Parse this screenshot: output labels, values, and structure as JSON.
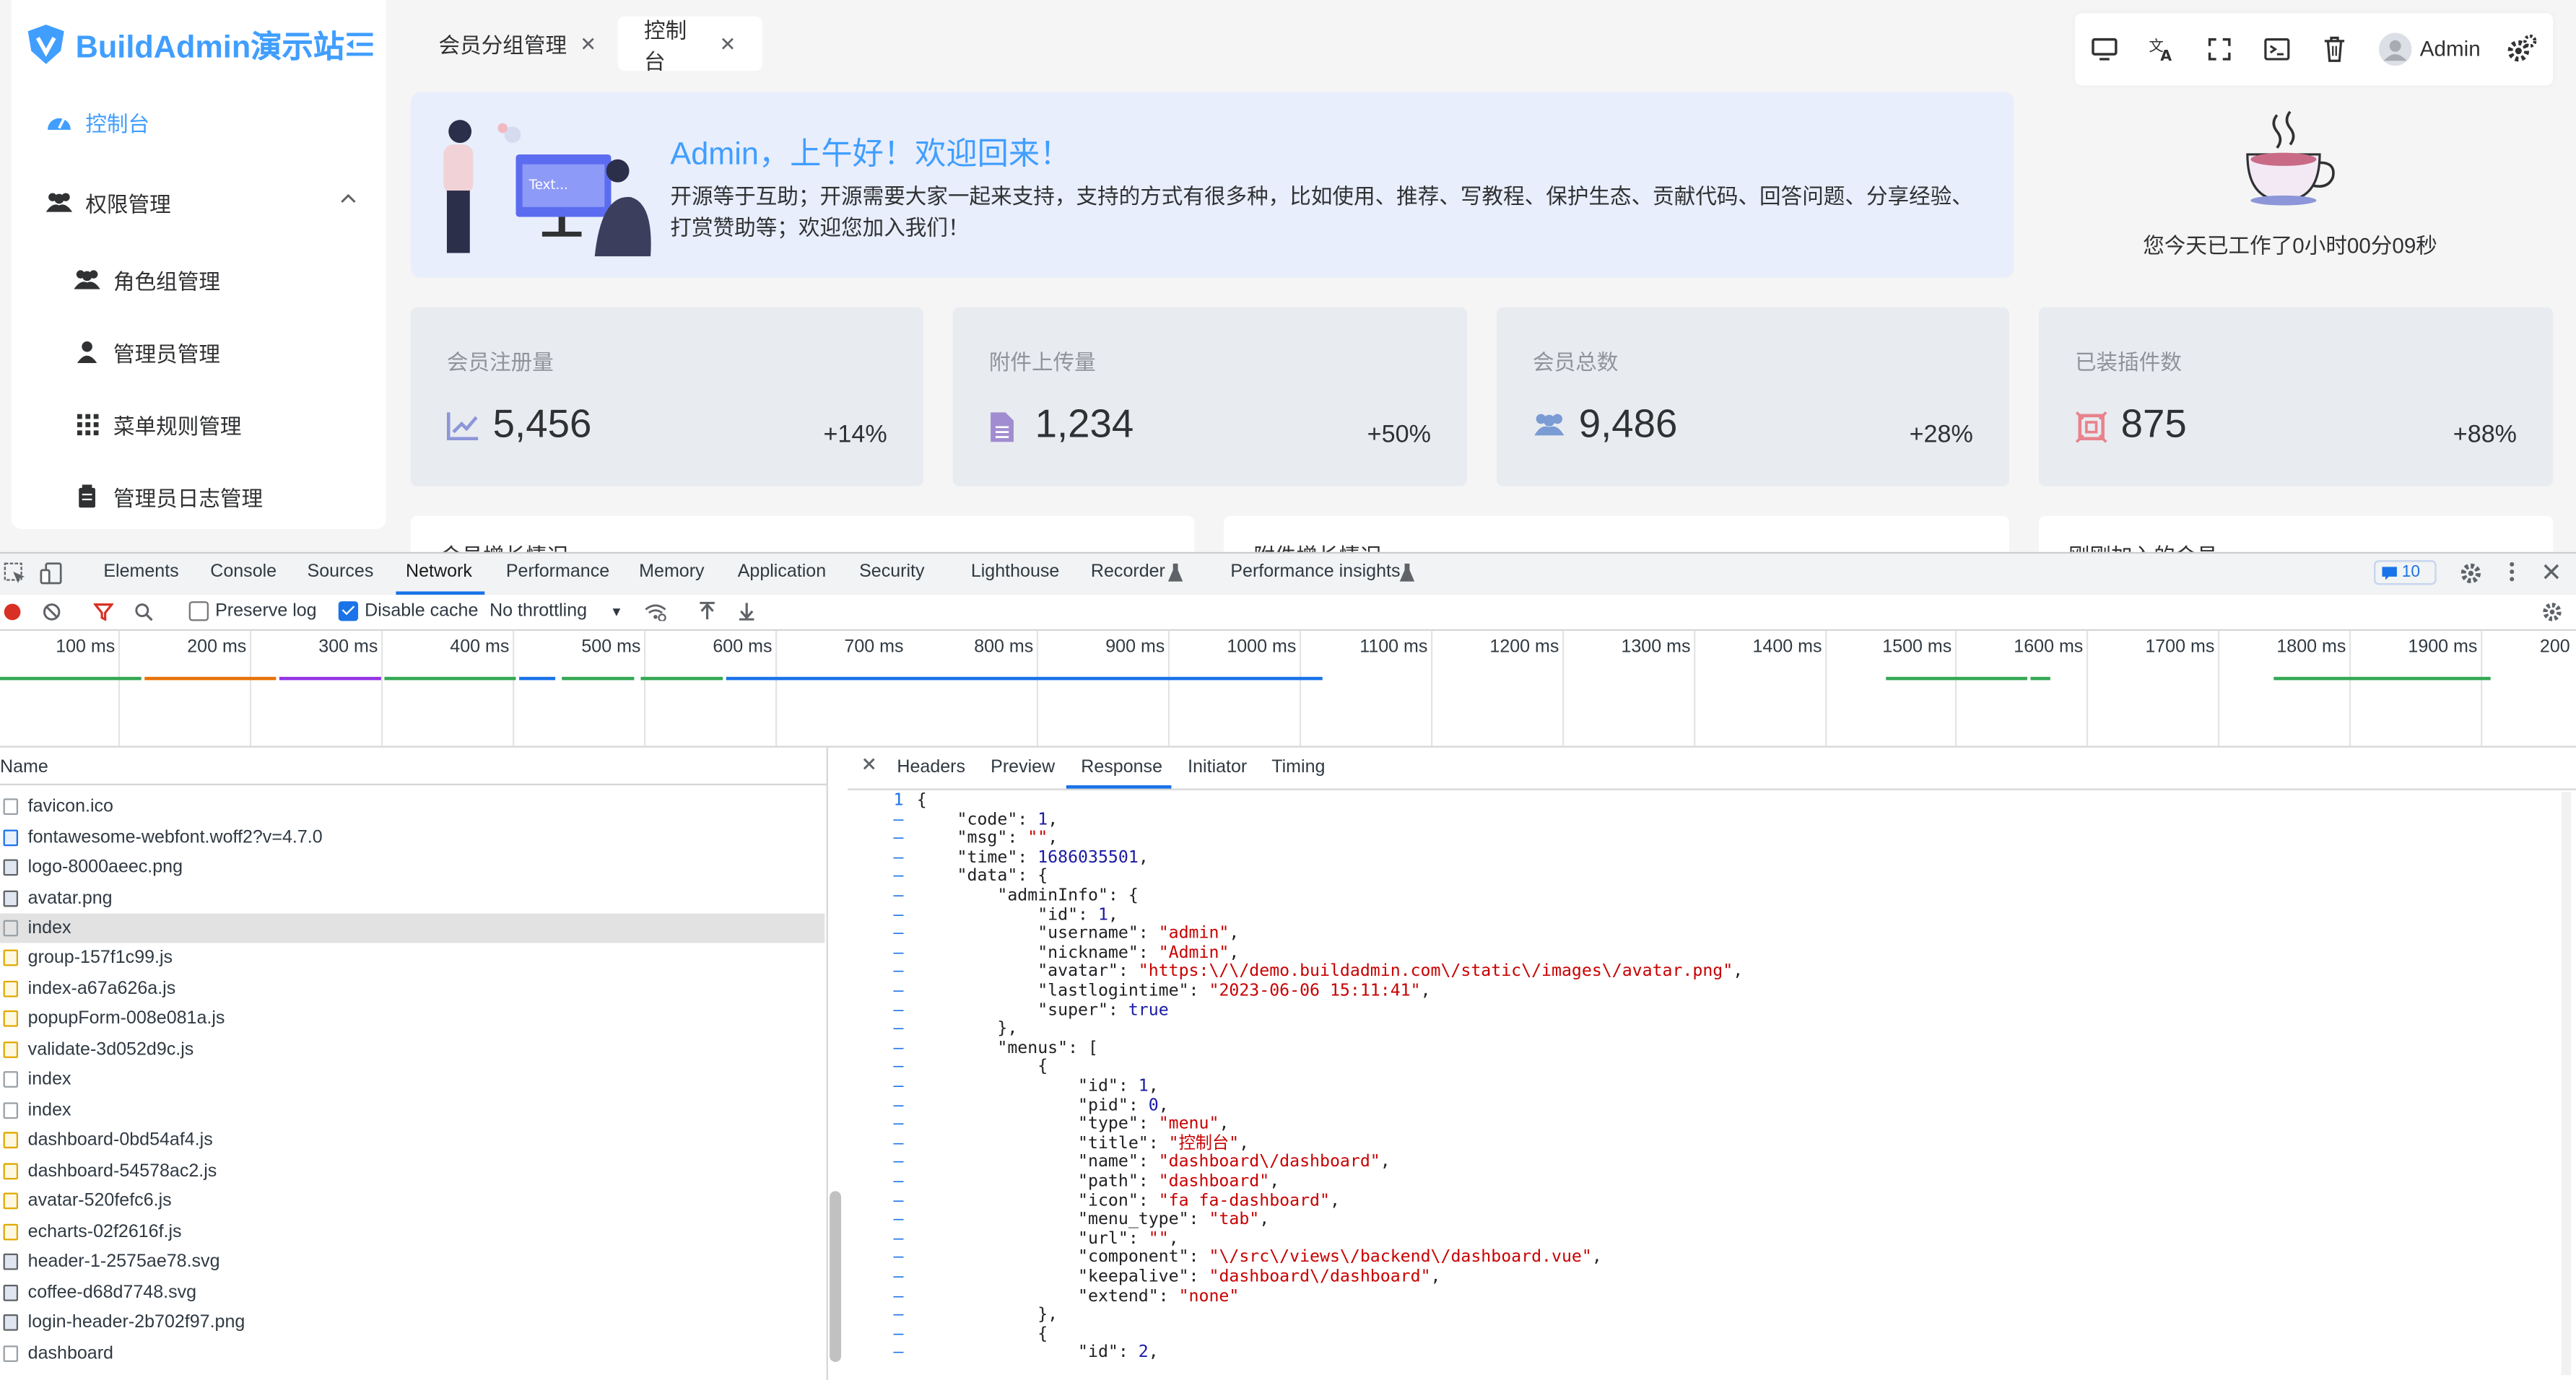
{
  "app": {
    "brand": "BuildAdmin演示站",
    "accent_color": "#409eff"
  },
  "sidebar": {
    "items": [
      {
        "label": "控制台",
        "icon": "dashboard-icon",
        "active": true
      },
      {
        "label": "权限管理",
        "icon": "users-icon",
        "expanded": true
      },
      {
        "label": "角色组管理",
        "icon": "users-group-icon"
      },
      {
        "label": "管理员管理",
        "icon": "user-icon"
      },
      {
        "label": "菜单规则管理",
        "icon": "grid-icon"
      },
      {
        "label": "管理员日志管理",
        "icon": "log-icon"
      }
    ]
  },
  "tabs": [
    {
      "label": "会员分组管理",
      "active": false
    },
    {
      "label": "控制台",
      "active": true
    }
  ],
  "toolbar": {
    "user_name": "Admin",
    "icons": [
      "monitor-icon",
      "translate-icon",
      "fullscreen-icon",
      "terminal-icon",
      "trash-icon",
      "avatar",
      "settings-icon"
    ]
  },
  "welcome": {
    "title": "Admin，上午好！欢迎回来！",
    "description": "开源等于互助；开源需要大家一起来支持，支持的方式有很多种，比如使用、推荐、写教程、保护生态、贡献代码、回答问题、分享经验、打赏赞助等；欢迎您加入我们！",
    "illustration_label": "Text...",
    "work_time": "您今天已工作了0小时00分09秒"
  },
  "stats": [
    {
      "label": "会员注册量",
      "value": "5,456",
      "change": "+14%",
      "icon": "trend-icon"
    },
    {
      "label": "附件上传量",
      "value": "1,234",
      "change": "+50%",
      "icon": "file-icon"
    },
    {
      "label": "会员总数",
      "value": "9,486",
      "change": "+28%",
      "icon": "users-icon"
    },
    {
      "label": "已装插件数",
      "value": "875",
      "change": "+88%",
      "icon": "plugin-icon"
    }
  ],
  "panels": [
    "会员增长情况",
    "附件增长情况",
    "刚刚加入的会员"
  ],
  "devtools": {
    "tabs": [
      "Elements",
      "Console",
      "Sources",
      "Network",
      "Performance",
      "Memory",
      "Application",
      "Security",
      "Lighthouse",
      "Recorder",
      "Performance insights"
    ],
    "active_tab": "Network",
    "issues_count": "10",
    "controls": {
      "preserve_log": "Preserve log",
      "preserve_log_checked": false,
      "disable_cache": "Disable cache",
      "disable_cache_checked": true,
      "throttling": "No throttling"
    },
    "timeline_ticks": [
      "100 ms",
      "200 ms",
      "300 ms",
      "400 ms",
      "500 ms",
      "600 ms",
      "700 ms",
      "800 ms",
      "900 ms",
      "1000 ms",
      "1100 ms",
      "1200 ms",
      "1300 ms",
      "1400 ms",
      "1500 ms",
      "1600 ms",
      "1700 ms",
      "1800 ms",
      "1900 ms",
      "200"
    ],
    "name_header": "Name",
    "requests": [
      {
        "name": "favicon.ico",
        "type": "doc"
      },
      {
        "name": "fontawesome-webfont.woff2?v=4.7.0",
        "type": "font"
      },
      {
        "name": "logo-8000aeec.png",
        "type": "img"
      },
      {
        "name": "avatar.png",
        "type": "img"
      },
      {
        "name": "index",
        "type": "doc",
        "selected": true
      },
      {
        "name": "group-157f1c99.js",
        "type": "js"
      },
      {
        "name": "index-a67a626a.js",
        "type": "js"
      },
      {
        "name": "popupForm-008e081a.js",
        "type": "js"
      },
      {
        "name": "validate-3d052d9c.js",
        "type": "js"
      },
      {
        "name": "index",
        "type": "doc"
      },
      {
        "name": "index",
        "type": "doc"
      },
      {
        "name": "dashboard-0bd54af4.js",
        "type": "js"
      },
      {
        "name": "dashboard-54578ac2.js",
        "type": "js"
      },
      {
        "name": "avatar-520fefc6.js",
        "type": "js"
      },
      {
        "name": "echarts-02f2616f.js",
        "type": "js"
      },
      {
        "name": "header-1-2575ae78.svg",
        "type": "img"
      },
      {
        "name": "coffee-d68d7748.svg",
        "type": "img"
      },
      {
        "name": "login-header-2b702f97.png",
        "type": "img"
      },
      {
        "name": "dashboard",
        "type": "doc"
      }
    ],
    "response_tabs": [
      "Headers",
      "Preview",
      "Response",
      "Initiator",
      "Timing"
    ],
    "active_response_tab": "Response",
    "response_lines": [
      "{",
      "    \"code\": 1,",
      "    \"msg\": \"\",",
      "    \"time\": 1686035501,",
      "    \"data\": {",
      "        \"adminInfo\": {",
      "            \"id\": 1,",
      "            \"username\": \"admin\",",
      "            \"nickname\": \"Admin\",",
      "            \"avatar\": \"https:\\/\\/demo.buildadmin.com\\/static\\/images\\/avatar.png\",",
      "            \"lastlogintime\": \"2023-06-06 15:11:41\",",
      "            \"super\": true",
      "        },",
      "        \"menus\": [",
      "            {",
      "                \"id\": 1,",
      "                \"pid\": 0,",
      "                \"type\": \"menu\",",
      "                \"title\": \"控制台\",",
      "                \"name\": \"dashboard\\/dashboard\",",
      "                \"path\": \"dashboard\",",
      "                \"icon\": \"fa fa-dashboard\",",
      "                \"menu_type\": \"tab\",",
      "                \"url\": \"\",",
      "                \"component\": \"\\/src\\/views\\/backend\\/dashboard.vue\",",
      "                \"keepalive\": \"dashboard\\/dashboard\",",
      "                \"extend\": \"none\"",
      "            },",
      "            {",
      "                \"id\": 2,"
    ]
  }
}
